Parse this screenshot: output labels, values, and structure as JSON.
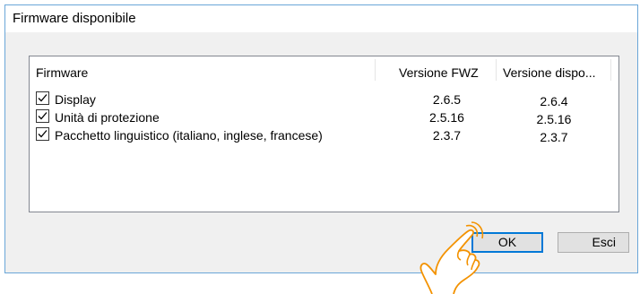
{
  "window": {
    "title": "Firmware disponibile"
  },
  "table": {
    "columns": [
      "Firmware",
      "Versione FWZ",
      "Versione dispo..."
    ],
    "rows": [
      {
        "name": "Display",
        "checked": true,
        "versione_fwz": "2.6.5",
        "versione_dispositivo": "2.6.4"
      },
      {
        "name": "Unità di protezione",
        "checked": true,
        "versione_fwz": "2.5.16",
        "versione_dispositivo": "2.5.16"
      },
      {
        "name": "Pacchetto linguistico (italiano, inglese, francese)",
        "checked": true,
        "versione_fwz": "2.3.7",
        "versione_dispositivo": "2.3.7"
      }
    ]
  },
  "buttons": {
    "ok": "OK",
    "esci": "Esci"
  },
  "colors": {
    "accent": "#0078d7",
    "hand_outline": "#f39200"
  },
  "icons": {
    "pointer": "hand-pointer-icon",
    "checkbox": "checkmark-icon"
  }
}
